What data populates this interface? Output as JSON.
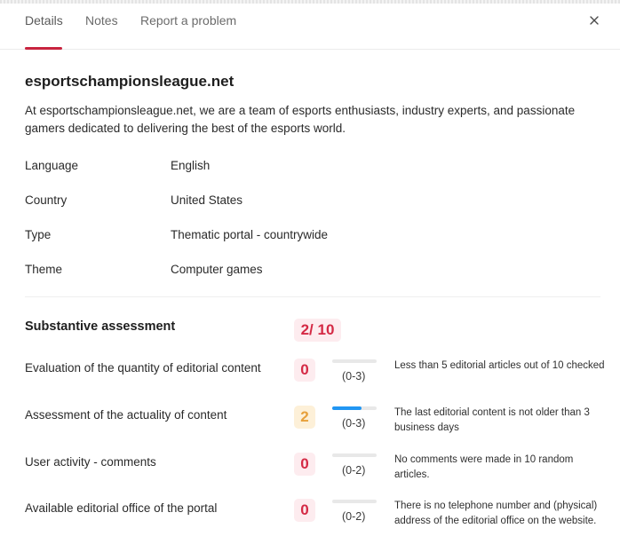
{
  "tabs": [
    {
      "label": "Details"
    },
    {
      "label": "Notes"
    },
    {
      "label": "Report a problem"
    }
  ],
  "site": {
    "title": "esportschampionsleague.net",
    "description": "At esportschampionsleague.net, we are a team of esports enthusiasts, industry experts, and passionate gamers dedicated to delivering the best of the esports world."
  },
  "info": [
    {
      "label": "Language",
      "value": "English"
    },
    {
      "label": "Country",
      "value": "United States"
    },
    {
      "label": "Type",
      "value": "Thematic portal - countrywide"
    },
    {
      "label": "Theme",
      "value": "Computer games"
    }
  ],
  "assessment": {
    "title": "Substantive assessment",
    "total": "2/ 10",
    "criteria": [
      {
        "label": "Evaluation of the quantity of editorial content",
        "score": "0",
        "max": 3,
        "range": "(0-3)",
        "note": "Less than 5 editorial articles out of 10 checked"
      },
      {
        "label": "Assessment of the actuality of content",
        "score": "2",
        "max": 3,
        "range": "(0-3)",
        "note": "The last editorial content is not older than 3 business days"
      },
      {
        "label": "User activity - comments",
        "score": "0",
        "max": 2,
        "range": "(0-2)",
        "note": "No comments were made in 10 random articles."
      },
      {
        "label": "Available editorial office of the portal",
        "score": "0",
        "max": 2,
        "range": "(0-2)",
        "note": "There is no telephone number and (physical) address of the editorial office on the website."
      }
    ]
  },
  "colors": {
    "accent": "#c8243f",
    "score_red": "#d42a45",
    "score_orange": "#e7a03b",
    "bar_blue": "#2196f3"
  }
}
